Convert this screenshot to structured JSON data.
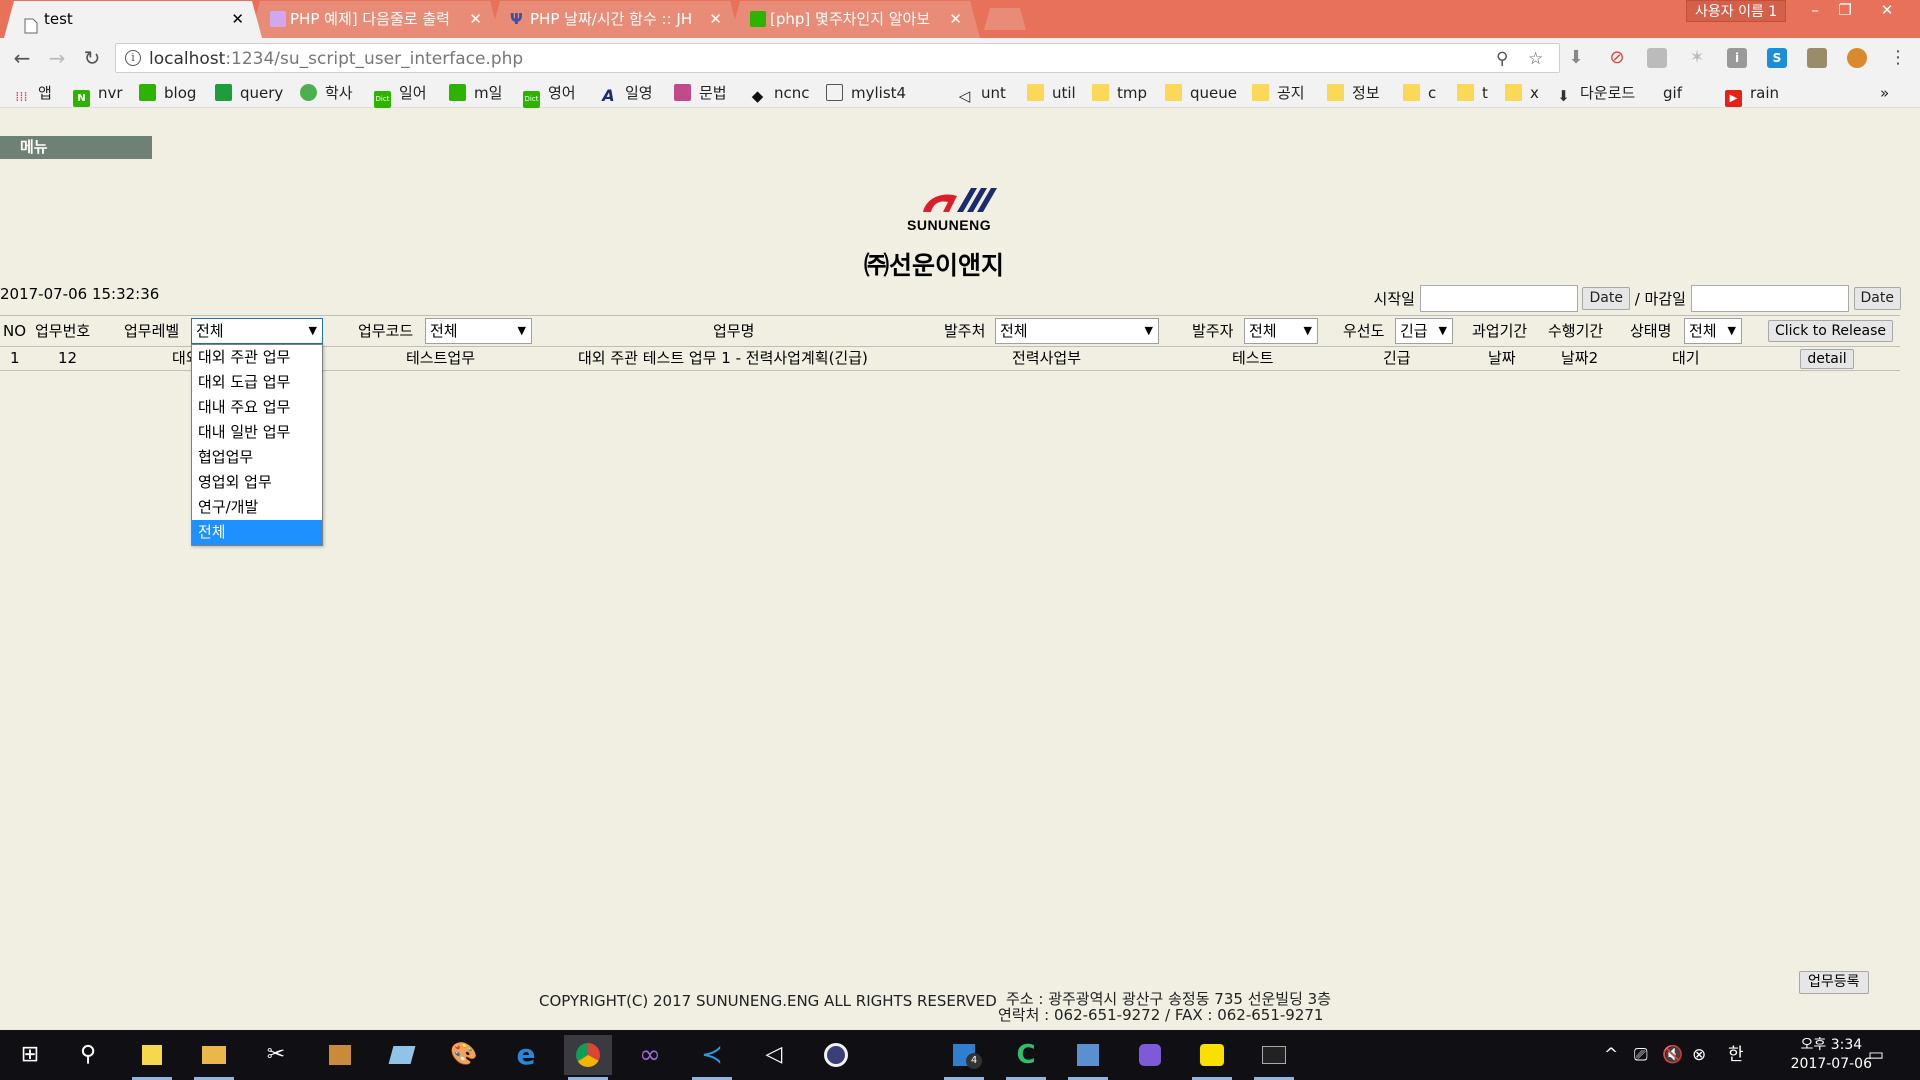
{
  "browser": {
    "tabs": [
      {
        "title": "test",
        "active": true
      },
      {
        "title": "PHP 예제] 다음줄로 출력",
        "active": false
      },
      {
        "title": "PHP 날짜/시간 함수 :: JH",
        "active": false
      },
      {
        "title": "[php] 몇주차인지 알아보",
        "active": false
      }
    ],
    "user_label": "사용자 이름 1",
    "url_host": "localhost",
    "url_path": ":1234/su_script_user_interface.php",
    "bookmarks": [
      "앱",
      "nvr",
      "blog",
      "query",
      "학사",
      "일어",
      "m일",
      "영어",
      "일영",
      "문법",
      "ncnc",
      "mylist4",
      "",
      "unt",
      "util",
      "tmp",
      "queue",
      "공지",
      "정보",
      "c",
      "t",
      "x",
      "다운로드",
      "gif",
      "rain"
    ],
    "bookmarks_more": "»"
  },
  "page": {
    "menu_label": "메뉴",
    "logo_text": "SUNUNENG",
    "company_name": "㈜선운이앤지",
    "clock": "2017-07-06 15:32:36",
    "date_filter": {
      "start_label": "시작일",
      "separator": "/ 마감일",
      "date_button": "Date"
    },
    "columns": {
      "no": "NO",
      "task_no": "업무번호",
      "task_level": "업무레벨",
      "task_code": "업무코드",
      "task_name": "업무명",
      "client": "발주처",
      "orderer": "발주자",
      "priority": "우선도",
      "past_period": "과업기간",
      "exec_period": "수행기간",
      "status": "상태명"
    },
    "filters": {
      "task_level": "전체",
      "task_code": "전체",
      "client": "전체",
      "orderer": "전체",
      "priority": "긴급",
      "status": "전체"
    },
    "release_button": "Click to Release",
    "rows": [
      {
        "no": "1",
        "task_no": "12",
        "task_level": "대외 주관 업무",
        "task_code": "테스트업무",
        "task_name": "대외 주관 테스트 업무 1 - 전력사업계획(긴급)",
        "client": "전력사업부",
        "orderer": "테스트",
        "priority": "긴급",
        "past_period": "날짜",
        "exec_period": "날짜2",
        "status": "대기",
        "action": "detail"
      }
    ],
    "level_dropdown_options": [
      "대외 주관 업무",
      "대외 도급 업무",
      "대내 주요 업무",
      "대내 일반 업무",
      "협업업무",
      "영업외 업무",
      "연구/개발",
      "전체"
    ],
    "level_dropdown_selected_index": 7,
    "register_button": "업무등록",
    "footer": {
      "copyright": "COPYRIGHT(C) 2017 SUNUNENG.ENG ALL RIGHTS RESERVED",
      "address": "주소 : 광주광역시 광산구 송정동 735 선운빌딩 3층",
      "contact": "연락처 : 062-651-9272 / FAX : 062-651-9271"
    }
  },
  "taskbar": {
    "time": "오후 3:34",
    "date": "2017-07-06",
    "ime": "한",
    "badge": "4"
  },
  "colors": {
    "tabbar": "#e8715a",
    "page_bg": "#f0efe2",
    "menu_bg": "#6f8075",
    "dropdown_selected": "#1e90ff"
  }
}
